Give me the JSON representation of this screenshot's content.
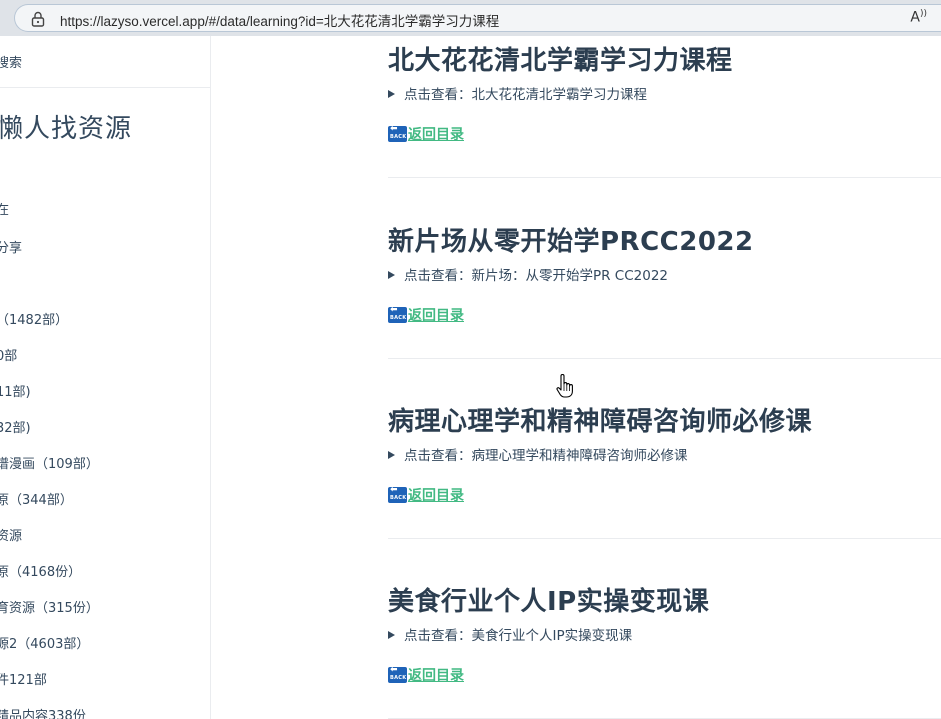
{
  "browser": {
    "url": "https://lazyso.vercel.app/#/data/learning?id=北大花花清北学霸学习力课程",
    "read_aloud_icon": "read-aloud-icon",
    "lock_icon": "lock-icon"
  },
  "sidebar": {
    "search_label": "搜索",
    "title": "懒人找资源",
    "items": [
      {
        "label": "在"
      },
      {
        "label": "分享"
      },
      {
        "label": "（1482部）"
      },
      {
        "label": "0部"
      },
      {
        "label": "11部)"
      },
      {
        "label": "32部)"
      },
      {
        "label": "谱漫画（109部）"
      },
      {
        "label": "原（344部）"
      },
      {
        "label": "资源"
      },
      {
        "label": "原（4168份）"
      },
      {
        "label": "育资源（315份）"
      },
      {
        "label": "源2（4603部）"
      },
      {
        "label": "件121部"
      },
      {
        "label": "精品内容338份"
      }
    ]
  },
  "main": {
    "sections": [
      {
        "title": "北大花花清北学霸学习力课程",
        "summary": "点击查看：北大花花清北学霸学习力课程",
        "back": "返回目录"
      },
      {
        "title": "新片场从零开始学PRCC2022",
        "summary": "点击查看：新片场：从零开始学PR CC2022",
        "back": "返回目录"
      },
      {
        "title": "病理心理学和精神障碍咨询师必修课",
        "summary": "点击查看：病理心理学和精神障碍咨询师必修课",
        "back": "返回目录"
      },
      {
        "title": "美食行业个人IP实操变现课",
        "summary": "点击查看：美食行业个人IP实操变现课",
        "back": "返回目录"
      }
    ],
    "back_icon_text": "BACK"
  },
  "colors": {
    "accent": "#42b983",
    "text": "#34495e",
    "heading": "#2c3e50",
    "back_icon": "#1f63b8"
  }
}
